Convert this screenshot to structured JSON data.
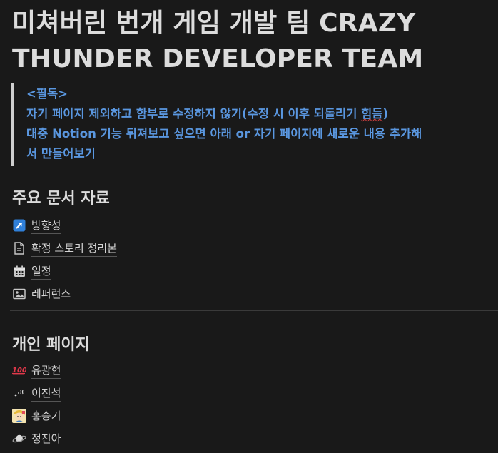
{
  "page": {
    "title_line1": "미쳐버린 번개 게임 개발 팀 CRAZY",
    "title_line2": "THUNDER DEVELOPER TEAM"
  },
  "callout": {
    "line1": "<필독>",
    "line2_a": "자기 페이지 제외하고 함부로 수정하지 ",
    "line2_b": "않기",
    "line2_c": "(수정 시 이후 되돌리기 ",
    "line2_d": "힘듬",
    "line2_e": ")",
    "line3": "대충 Notion 기능 뒤져보고 싶으면 아래 or 자기 페이지에 새로운 내용 추가해",
    "line4": "서 만들어보기",
    "text_color": "#5a97e0"
  },
  "sections": {
    "main_docs": {
      "heading": "주요 문서 자료",
      "items": [
        {
          "label": "방향성",
          "icon": "arrow-up-right-icon"
        },
        {
          "label": "확정 스토리 정리본",
          "icon": "document-icon"
        },
        {
          "label": "일정",
          "icon": "calendar-icon"
        },
        {
          "label": "레퍼런스",
          "icon": "image-icon"
        }
      ]
    },
    "personal": {
      "heading": "개인 페이지",
      "items": [
        {
          "label": "유광현",
          "icon": "hundred-points-icon"
        },
        {
          "label": "이진석",
          "icon": "sparkle-icon"
        },
        {
          "label": "홍승기",
          "icon": "character-icon"
        },
        {
          "label": "정진아",
          "icon": "planet-icon"
        }
      ]
    }
  },
  "colors": {
    "background": "#191919",
    "text": "#d4d4d4",
    "accent_blue": "#5a97e0",
    "link_icon_blue": "#2f7fd8"
  }
}
